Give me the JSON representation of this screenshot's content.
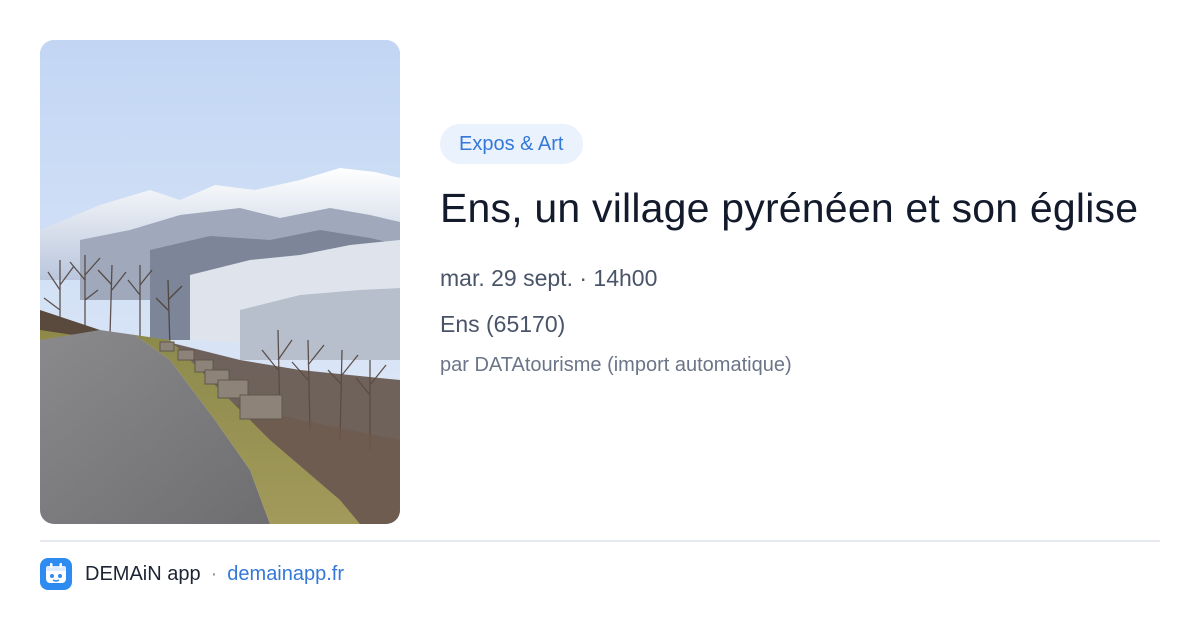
{
  "event": {
    "category_tag": "Expos & Art",
    "title": "Ens, un village pyrénéen et son église",
    "date_time": "mar. 29 sept. · 14h00",
    "location": "Ens (65170)",
    "source": "par DATAtourisme (import automatique)"
  },
  "photo": {
    "subject": "snowy mountains road landscape"
  },
  "footer": {
    "app_name": "DEMAiN app",
    "separator": "·",
    "link": "demainapp.fr",
    "icon": "demain-app-logo-icon"
  },
  "colors": {
    "accent": "#3478d8",
    "tag_bg": "#eaf2fd",
    "title": "#121a2c",
    "meta": "#4a5468",
    "divider": "#e3e9ef",
    "app_icon_bg": "#2e8cf0"
  }
}
